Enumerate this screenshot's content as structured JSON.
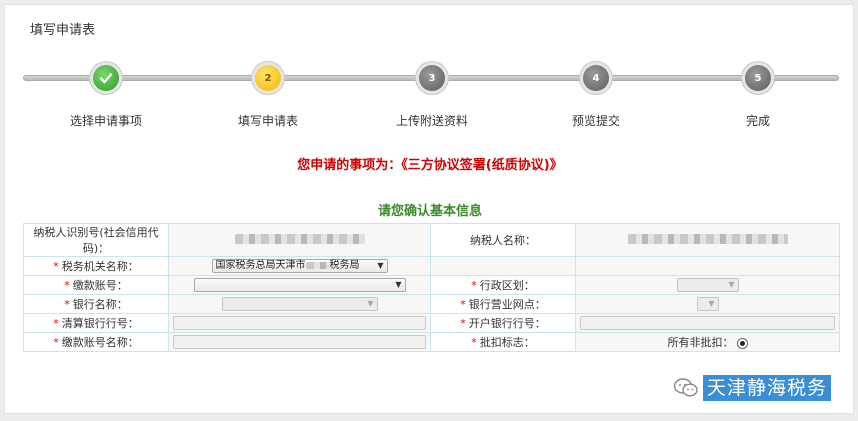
{
  "page_title": "填写申请表",
  "steps": [
    {
      "number": "1",
      "label": "选择申请事项",
      "state": "done"
    },
    {
      "number": "2",
      "label": "填写申请表",
      "state": "current"
    },
    {
      "number": "3",
      "label": "上传附送资料",
      "state": "todo"
    },
    {
      "number": "4",
      "label": "预览提交",
      "state": "todo"
    },
    {
      "number": "5",
      "label": "完成",
      "state": "todo"
    }
  ],
  "notice": "您申请的事项为：《三方协议签署(纸质协议)》",
  "section_title": "请您确认基本信息",
  "form": {
    "taxpayer_id_label": "纳税人识别号(社会信用代码)：",
    "taxpayer_name_label": "纳税人名称：",
    "tax_office_label": "税务机关名称：",
    "tax_office_value_prefix": "国家税务总局天津市",
    "tax_office_value_suffix": "税务局",
    "payment_account_label": "缴款账号：",
    "admin_region_label": "行政区划：",
    "bank_name_label": "银行名称：",
    "bank_branch_label": "银行营业网点：",
    "clearing_bank_label": "清算银行行号：",
    "opening_bank_label": "开户银行行号：",
    "account_name_label": "缴款账号名称：",
    "batch_flag_label": "批扣标志：",
    "batch_flag_value": "所有非批扣："
  },
  "required_mark": "*",
  "watermark": "天津静海税务",
  "colors": {
    "accent_red": "#d40000",
    "accent_green": "#3a8b2a",
    "step_done": "#2f9a2a",
    "step_current": "#f2b705"
  }
}
